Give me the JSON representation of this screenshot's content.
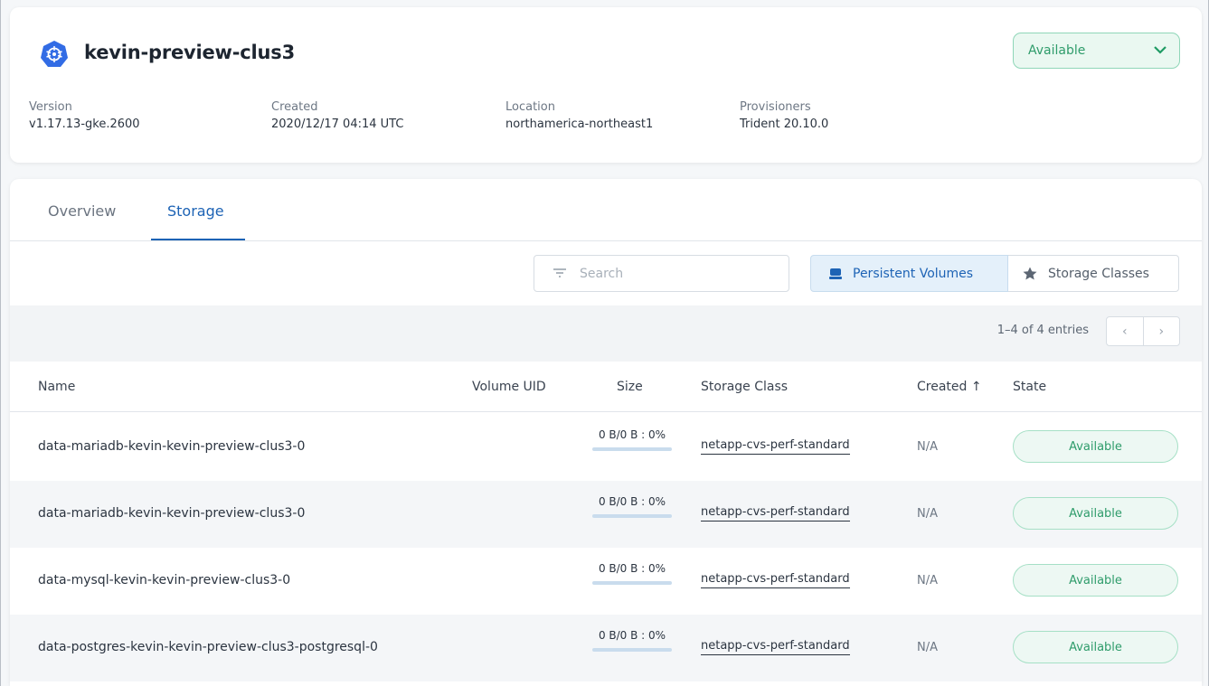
{
  "cluster": {
    "title": "kevin-preview-clus3",
    "status": "Available",
    "meta": [
      {
        "label": "Version",
        "value": "v1.17.13-gke.2600"
      },
      {
        "label": "Created",
        "value": "2020/12/17 04:14 UTC"
      },
      {
        "label": "Location",
        "value": "northamerica-northeast1"
      },
      {
        "label": "Provisioners",
        "value": "Trident 20.10.0"
      }
    ]
  },
  "tabs": [
    {
      "label": "Overview",
      "active": false
    },
    {
      "label": "Storage",
      "active": true
    }
  ],
  "toolbar": {
    "search_placeholder": "Search",
    "persistent_volumes_label": "Persistent Volumes",
    "storage_classes_label": "Storage Classes"
  },
  "pagination": {
    "entries_text": "1–4 of 4 entries",
    "prev_icon": "‹",
    "next_icon": "›"
  },
  "table": {
    "columns": [
      "Name",
      "Volume UID",
      "Size",
      "Storage Class",
      "Created ↑",
      "State"
    ],
    "rows": [
      {
        "name": "data-mariadb-kevin-kevin-preview-clus3-0",
        "size": "0 B/0 B : 0%",
        "storage_class": "netapp-cvs-perf-standard",
        "created": "N/A",
        "state": "Available"
      },
      {
        "name": "data-mariadb-kevin-kevin-preview-clus3-0",
        "size": "0 B/0 B : 0%",
        "storage_class": "netapp-cvs-perf-standard",
        "created": "N/A",
        "state": "Available"
      },
      {
        "name": "data-mysql-kevin-kevin-preview-clus3-0",
        "size": "0 B/0 B : 0%",
        "storage_class": "netapp-cvs-perf-standard",
        "created": "N/A",
        "state": "Available"
      },
      {
        "name": "data-postgres-kevin-kevin-preview-clus3-postgresql-0",
        "size": "0 B/0 B : 0%",
        "storage_class": "netapp-cvs-perf-standard",
        "created": "N/A",
        "state": "Available"
      }
    ]
  },
  "colors": {
    "accent_blue": "#1d63b5",
    "status_green": "#2f9c6b",
    "kubernetes_blue": "#326ce5"
  },
  "icons": {
    "cluster": "kubernetes-icon",
    "dropdown": "chevron-down-icon",
    "search": "filter-icon",
    "persistent_volumes": "disk-icon",
    "storage_classes": "star-icon"
  }
}
